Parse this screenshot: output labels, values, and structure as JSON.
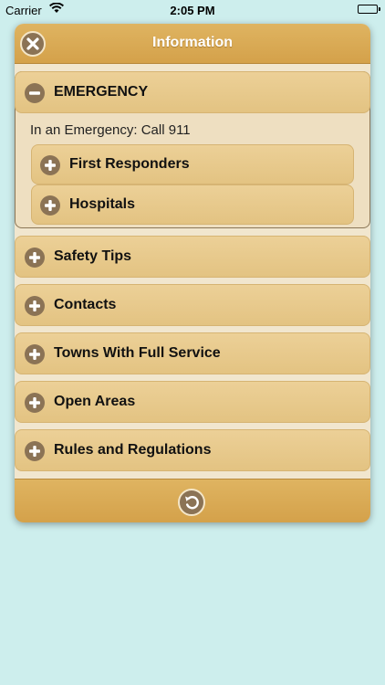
{
  "status_bar": {
    "carrier": "Carrier",
    "time": "2:05 PM"
  },
  "dialog": {
    "title": "Information",
    "close_icon": "close-icon",
    "back_icon": "undo-icon"
  },
  "emergency": {
    "label": "EMERGENCY",
    "expanded": true,
    "text": "In an Emergency: Call 911",
    "sub_sections": [
      {
        "label": "First Responders",
        "expanded": false
      },
      {
        "label": "Hospitals",
        "expanded": false
      }
    ]
  },
  "sections": [
    {
      "label": "Safety Tips",
      "expanded": false
    },
    {
      "label": "Contacts",
      "expanded": false
    },
    {
      "label": "Towns With Full Service",
      "expanded": false
    },
    {
      "label": "Open Areas",
      "expanded": false
    },
    {
      "label": "Rules and Regulations",
      "expanded": false
    }
  ],
  "colors": {
    "background": "#cdeeed",
    "header": "#d9a955",
    "section": "#e8ca8c",
    "icon": "#8b7355"
  }
}
